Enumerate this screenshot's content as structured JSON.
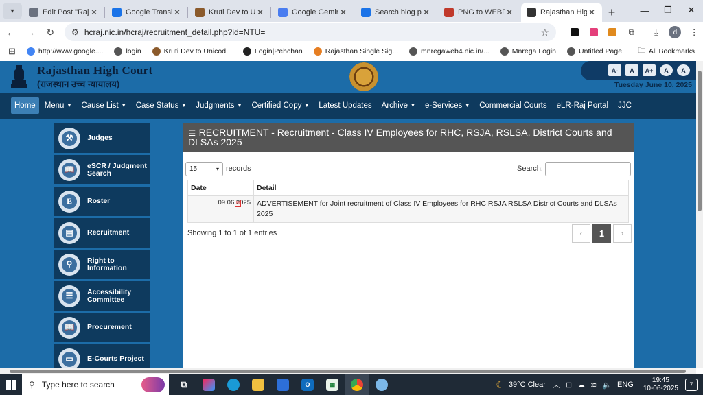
{
  "browser": {
    "tabs": [
      {
        "label": "Edit Post \"Rajasth",
        "icon": "document-icon",
        "color": "#6b7280"
      },
      {
        "label": "Google Translate",
        "icon": "translate-icon",
        "color": "#1a73e8"
      },
      {
        "label": "Kruti Dev to Unic",
        "icon": "kruti-icon",
        "color": "#8b5a2b"
      },
      {
        "label": "Google Gemini",
        "icon": "gemini-icon",
        "color": "#4a7df0"
      },
      {
        "label": "Search blog post",
        "icon": "search-blog-icon",
        "color": "#1a73e8"
      },
      {
        "label": "PNG to WEBP | C",
        "icon": "cloud-icon",
        "color": "#c0392b"
      },
      {
        "label": "Rajasthan High C",
        "icon": "court-icon",
        "color": "#333333",
        "active": true
      }
    ],
    "url": "hcraj.nic.in/hcraj/recruitment_detail.php?id=NTU=",
    "profile_initial": "d",
    "bookmarks": [
      {
        "label": "http://www.google....",
        "icon": "google-icon",
        "color": "#4285f4"
      },
      {
        "label": "login",
        "icon": "globe-icon",
        "color": "#555555"
      },
      {
        "label": "Kruti Dev to Unicod...",
        "icon": "kruti-icon",
        "color": "#8b5a2b"
      },
      {
        "label": "Login|Pehchan",
        "icon": "pehchan-icon",
        "color": "#222222"
      },
      {
        "label": "Rajasthan Single Sig...",
        "icon": "rajasthan-icon",
        "color": "#e67e22"
      },
      {
        "label": "mnregaweb4.nic.in/...",
        "icon": "globe-icon",
        "color": "#555555"
      },
      {
        "label": "Mnrega Login",
        "icon": "globe-icon",
        "color": "#555555"
      },
      {
        "label": "Untitled Page",
        "icon": "globe-icon",
        "color": "#555555"
      }
    ],
    "all_bookmarks": "All Bookmarks"
  },
  "site": {
    "title": "Rajasthan High Court",
    "title_hindi": "(राजस्थान उच्च न्यायालय)",
    "font_buttons": [
      "A-",
      "A",
      "A+",
      "A",
      "A"
    ],
    "date": "Tuesday June 10, 2025",
    "nav": [
      {
        "label": "Home",
        "dropdown": false
      },
      {
        "label": "Menu",
        "dropdown": true
      },
      {
        "label": "Cause List",
        "dropdown": true
      },
      {
        "label": "Case Status",
        "dropdown": true
      },
      {
        "label": "Judgments",
        "dropdown": true
      },
      {
        "label": "Certified Copy",
        "dropdown": true
      },
      {
        "label": "Latest Updates",
        "dropdown": false
      },
      {
        "label": "Archive",
        "dropdown": true
      },
      {
        "label": "e-Services",
        "dropdown": true
      },
      {
        "label": "Commercial Courts",
        "dropdown": false
      },
      {
        "label": "eLR-Raj Portal",
        "dropdown": false
      },
      {
        "label": "JJC",
        "dropdown": false
      }
    ],
    "sidebar": [
      {
        "label": "Judges",
        "icon": "gavel-icon",
        "glyph": "⚒"
      },
      {
        "label": "eSCR / Judgment Search",
        "icon": "book-icon",
        "glyph": "📖"
      },
      {
        "label": "Roster",
        "icon": "roster-icon",
        "glyph": "E"
      },
      {
        "label": "Recruitment",
        "icon": "id-card-icon",
        "glyph": "▤"
      },
      {
        "label": "Right to Information",
        "icon": "magnifier-icon",
        "glyph": "⚲"
      },
      {
        "label": "Accessibility Committee",
        "icon": "document-icon",
        "glyph": "☰"
      },
      {
        "label": "Procurement",
        "icon": "book-icon",
        "glyph": "📖"
      },
      {
        "label": "E-Courts Project",
        "icon": "monitor-icon",
        "glyph": "▭"
      }
    ]
  },
  "panel": {
    "heading": "RECRUITMENT - Recruitment - Class IV Employees for RHC, RSJA, RSLSA, District Courts and DLSAs 2025",
    "page_length": "15",
    "records_label": "records",
    "search_label": "Search:",
    "search_value": "",
    "columns": [
      "Date",
      "Detail"
    ],
    "rows": [
      {
        "date": "09.06.2025",
        "detail": "ADVERTISEMENT for Joint recruitment of Class IV Employees for RHC RSJA RSLSA District Courts and DLSAs 2025"
      }
    ],
    "info": "Showing 1 to 1 of 1 entries",
    "pagination": {
      "prev": "‹",
      "current": "1",
      "next": "›"
    }
  },
  "taskbar": {
    "search_placeholder": "Type here to search",
    "weather": "39°C  Clear",
    "language": "ENG",
    "time": "19:45",
    "date": "10-06-2025",
    "notifications": "7"
  },
  "colors": {
    "site_blue": "#1c6ca8",
    "nav_dark": "#0e3a5e",
    "panel_head": "#555555"
  }
}
